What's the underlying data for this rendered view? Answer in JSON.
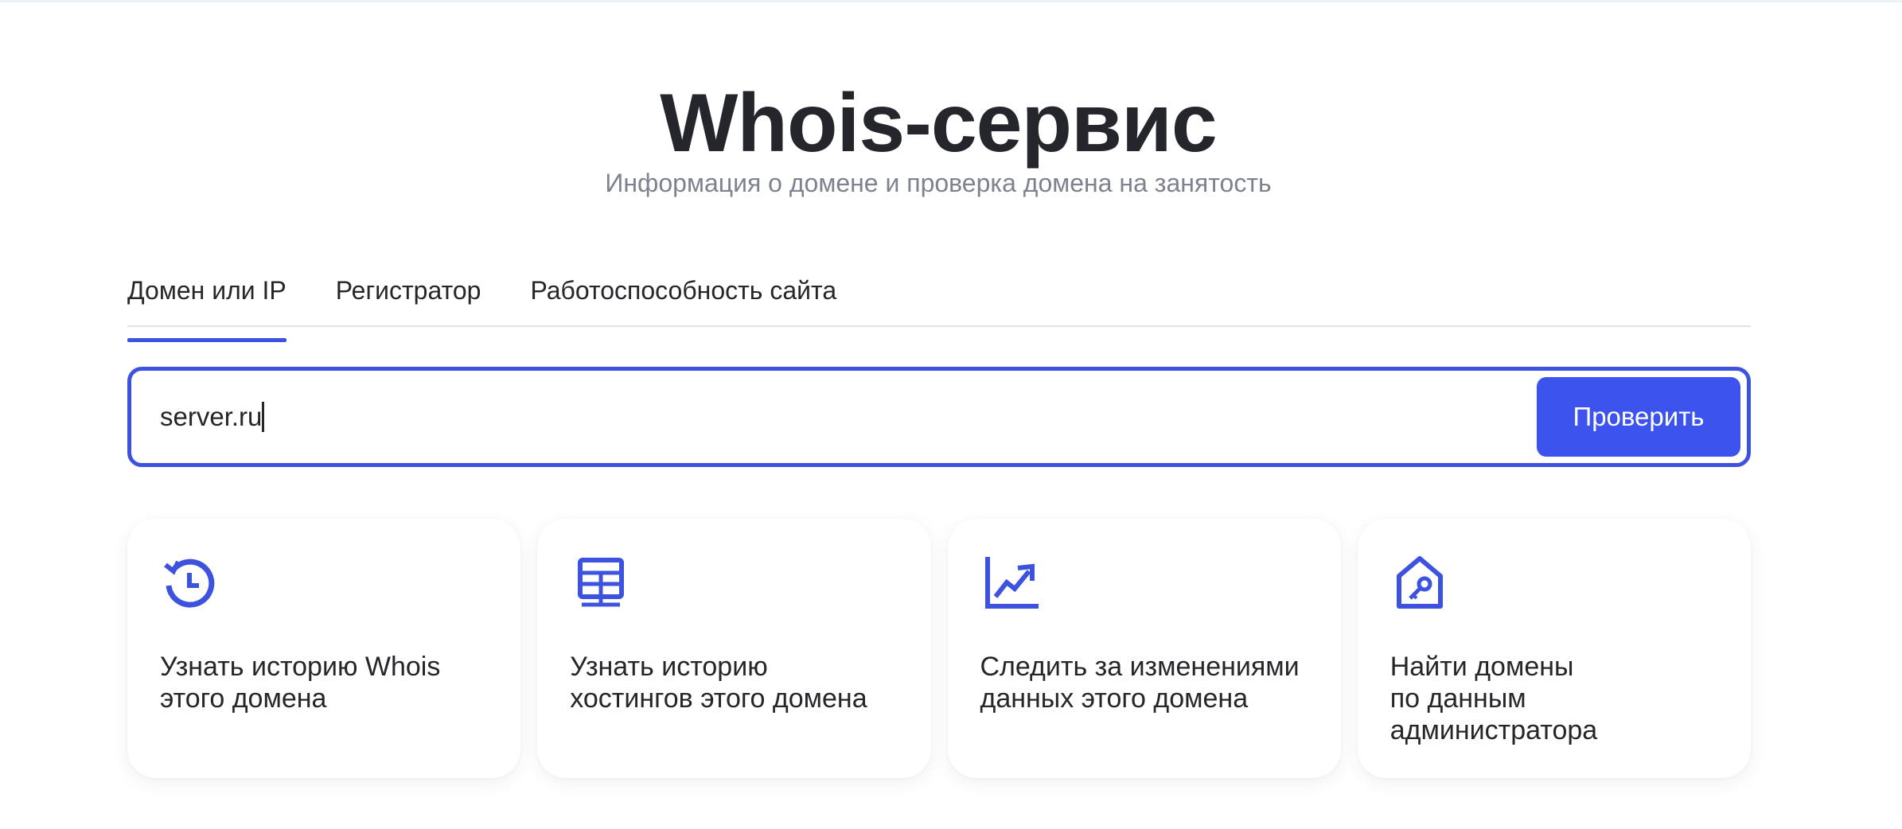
{
  "header": {
    "title": "Whois-сервис",
    "subtitle": "Информация о домене и проверка домена на занятость"
  },
  "tabs": [
    {
      "label": "Домен или IP",
      "active": true
    },
    {
      "label": "Регистратор",
      "active": false
    },
    {
      "label": "Работоспособность сайта",
      "active": false
    }
  ],
  "search": {
    "value": "server.ru",
    "button_label": "Проверить"
  },
  "cards": [
    {
      "icon": "history-icon",
      "text": "Узнать историю Whois\nэтого домена"
    },
    {
      "icon": "server-icon",
      "text": "Узнать историю\nхостингов этого домена"
    },
    {
      "icon": "chart-trend-icon",
      "text": "Следить за изменениями\nданных этого домена"
    },
    {
      "icon": "house-key-icon",
      "text": "Найти домены\nпо данным\nадминистратора"
    }
  ],
  "colors": {
    "accent": "#3d53e0",
    "text": "#24262b",
    "muted": "#7d828f"
  }
}
